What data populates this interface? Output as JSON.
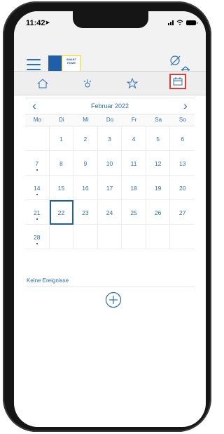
{
  "status_bar": {
    "time": "11:42"
  },
  "header": {
    "logo_text": "SMART HOME"
  },
  "tabs": [
    {
      "id": "home",
      "icon": "home-icon"
    },
    {
      "id": "devices",
      "icon": "thermostat-icon"
    },
    {
      "id": "favorites",
      "icon": "star-icon"
    },
    {
      "id": "calendar",
      "icon": "calendar-icon",
      "active": true
    }
  ],
  "calendar": {
    "month_label": "Februar 2022",
    "weekdays": [
      "Mo",
      "Di",
      "Mi",
      "Do",
      "Fr",
      "Sa",
      "So"
    ],
    "selected_day": "22",
    "days": [
      {
        "d": ""
      },
      {
        "d": "1"
      },
      {
        "d": "2"
      },
      {
        "d": "3"
      },
      {
        "d": "4"
      },
      {
        "d": "5"
      },
      {
        "d": "6"
      },
      {
        "d": "7",
        "dot": true
      },
      {
        "d": "8"
      },
      {
        "d": "9"
      },
      {
        "d": "10"
      },
      {
        "d": "11"
      },
      {
        "d": "12"
      },
      {
        "d": "13"
      },
      {
        "d": "14",
        "dot": true
      },
      {
        "d": "15"
      },
      {
        "d": "16"
      },
      {
        "d": "17"
      },
      {
        "d": "18"
      },
      {
        "d": "19"
      },
      {
        "d": "20"
      },
      {
        "d": "21",
        "dot": true
      },
      {
        "d": "22"
      },
      {
        "d": "23"
      },
      {
        "d": "24"
      },
      {
        "d": "25"
      },
      {
        "d": "26"
      },
      {
        "d": "27"
      },
      {
        "d": "28",
        "dot": true
      },
      {
        "d": ""
      },
      {
        "d": ""
      },
      {
        "d": ""
      },
      {
        "d": ""
      },
      {
        "d": ""
      },
      {
        "d": ""
      }
    ]
  },
  "events": {
    "empty_label": "Keine Ereignisse"
  },
  "colors": {
    "accent": "#2b6fb6",
    "brand": "#1f5ea8",
    "highlight": "#e53935",
    "logo_yellow": "#f3d300"
  }
}
